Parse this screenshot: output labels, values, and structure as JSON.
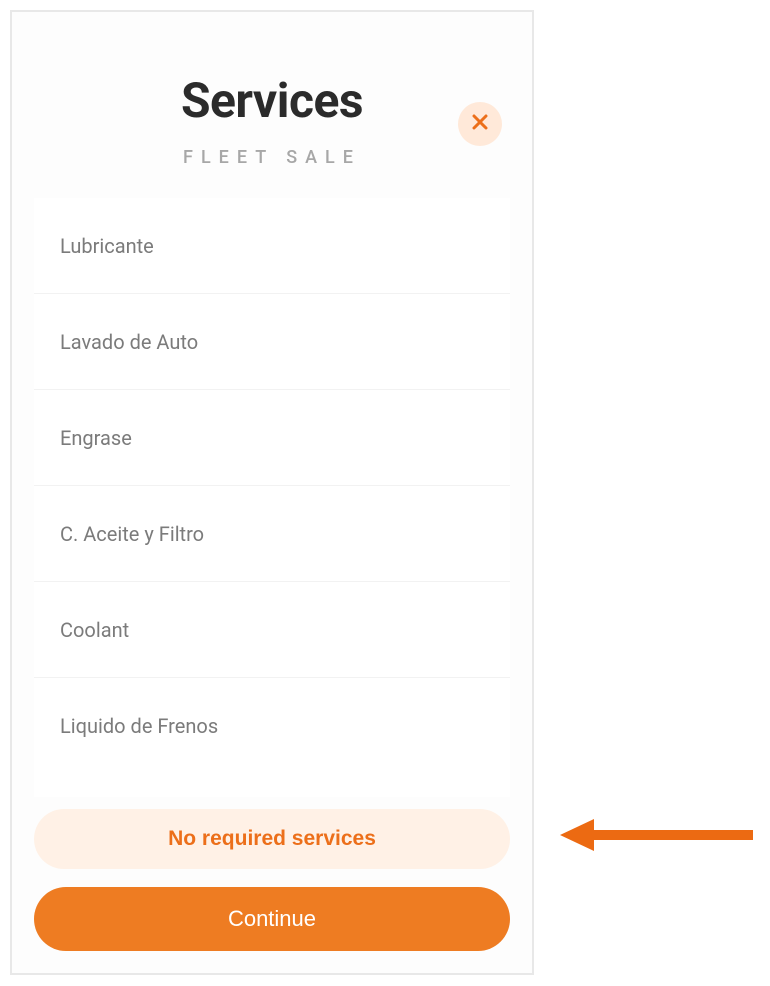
{
  "header": {
    "title": "Services",
    "subtitle": "FLEET SALE"
  },
  "services": {
    "items": [
      {
        "label": "Lubricante"
      },
      {
        "label": "Lavado de Auto"
      },
      {
        "label": "Engrase"
      },
      {
        "label": "C. Aceite y Filtro"
      },
      {
        "label": "Coolant"
      },
      {
        "label": "Liquido de Frenos"
      }
    ]
  },
  "footer": {
    "no_required_label": "No required services",
    "continue_label": "Continue"
  },
  "colors": {
    "accent": "#ee7c22",
    "accent_light": "#fff1e6"
  }
}
